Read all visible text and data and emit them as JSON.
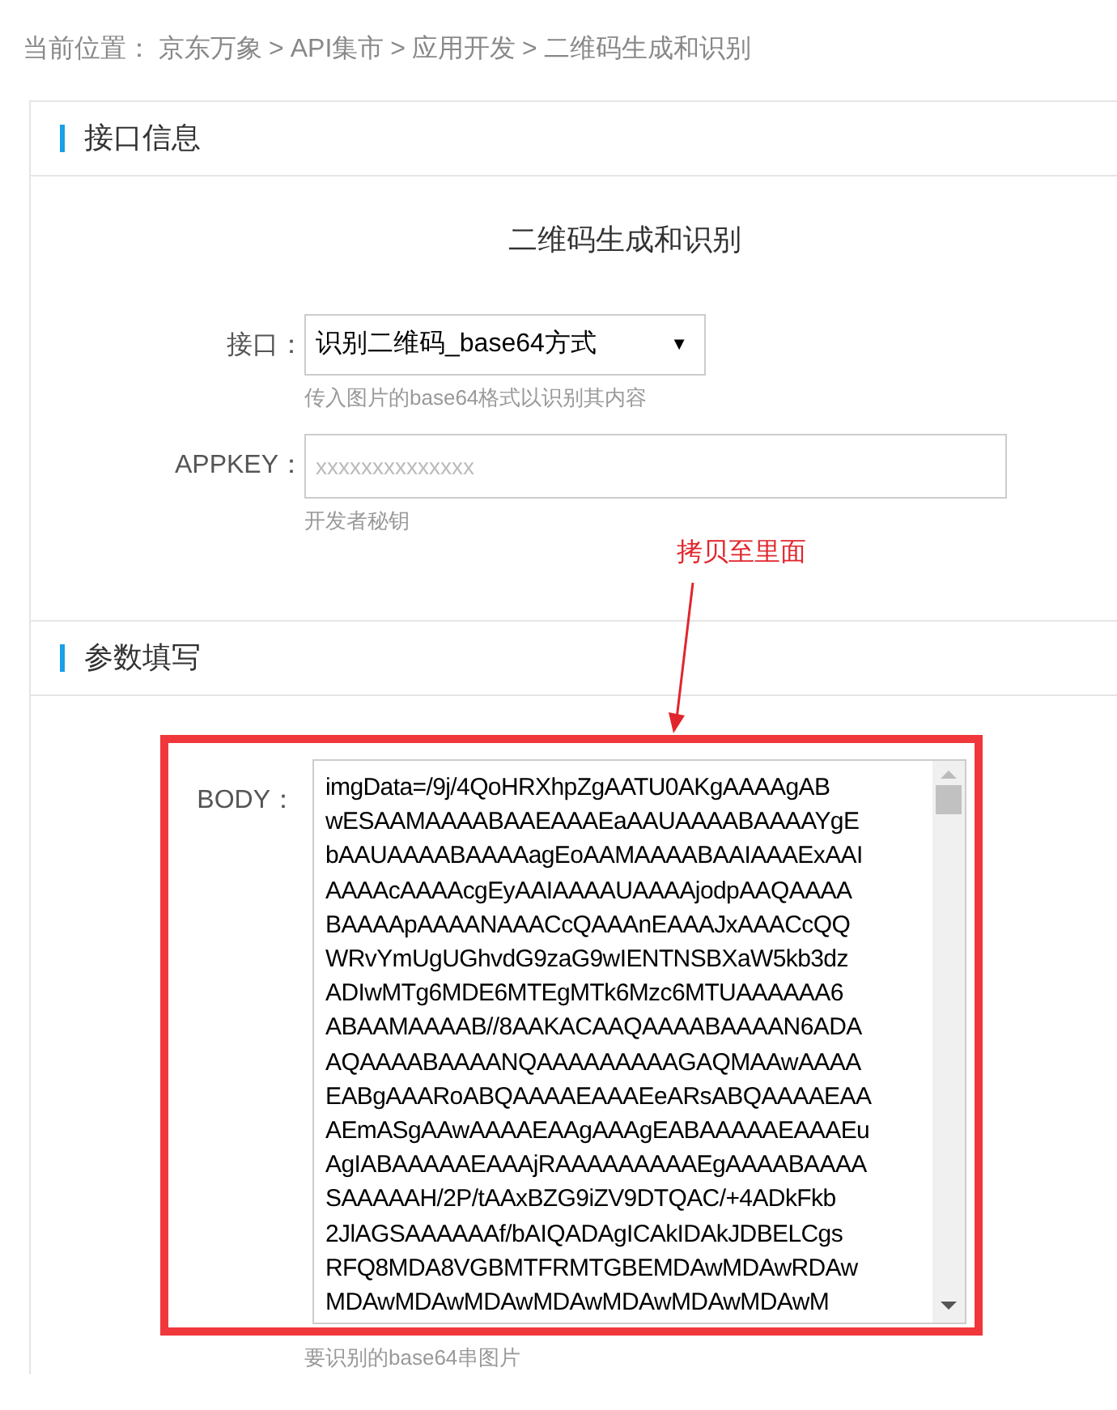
{
  "breadcrumb": {
    "label": "当前位置：",
    "items": [
      "京东万象",
      "API集市",
      "应用开发",
      "二维码生成和识别"
    ],
    "separator": ">"
  },
  "interface_section": {
    "heading": "接口信息",
    "api_title": "二维码生成和识别",
    "fields": [
      {
        "kind": "select",
        "label": "接口：",
        "value": "识别二维码_base64方式",
        "caret": "▼",
        "hint": "传入图片的base64格式以识别其内容"
      },
      {
        "kind": "input",
        "label": "APPKEY：",
        "placeholder": "xxxxxxxxxxxxxx",
        "hint": "开发者秘钥"
      }
    ]
  },
  "annotation": {
    "text": "拷贝至里面"
  },
  "params_section": {
    "heading": "参数填写",
    "body_field": {
      "label": "BODY：",
      "value": "imgData=/9j/4QoHRXhpZgAATU0AKgAAAAgAB\nwESAAMAAAABAAEAAAEaAAUAAAABAAAAYgE\nbAAUAAAABAAAAagEoAAMAAAABAAIAAAExAAI\nAAAAcAAAAcgEyAAIAAAAUAAAAjodpAAQAAAA\nBAAAApAAAANAAACcQAAAnEAAAJxAAACcQQ\nWRvYmUgUGhvdG9zaG9wIENTNSBXaW5kb3dz\nADIwMTg6MDE6MTEgMTk6Mzc6MTUAAAAAA6\nABAAMAAAAB//8AAKACAAQAAAABAAAAN6ADA\nAQAAAABAAAANQAAAAAAAAAGAQMAAwAAAA\nEABgAAARoABQAAAAEAAAEeARsABQAAAAEAA\nAEmASgAAwAAAAEAAgAAAgEABAAAAAEAAAEu\nAgIABAAAAAEAAAjRAAAAAAAAAEgAAAABAAAA\nSAAAAAH/2P/tAAxBZG9iZV9DTQAC/+4ADkFkb\n2JlAGSAAAAAAf/bAIQADAgICAkIDAkJDBELCgs\nRFQ8MDA8VGBMTFRMTGBEMDAwMDAwRDAw\nMDAwMDAwMDAwMDAwMDAwMDAwMDAwM",
      "hint": "要识别的base64串图片"
    }
  }
}
